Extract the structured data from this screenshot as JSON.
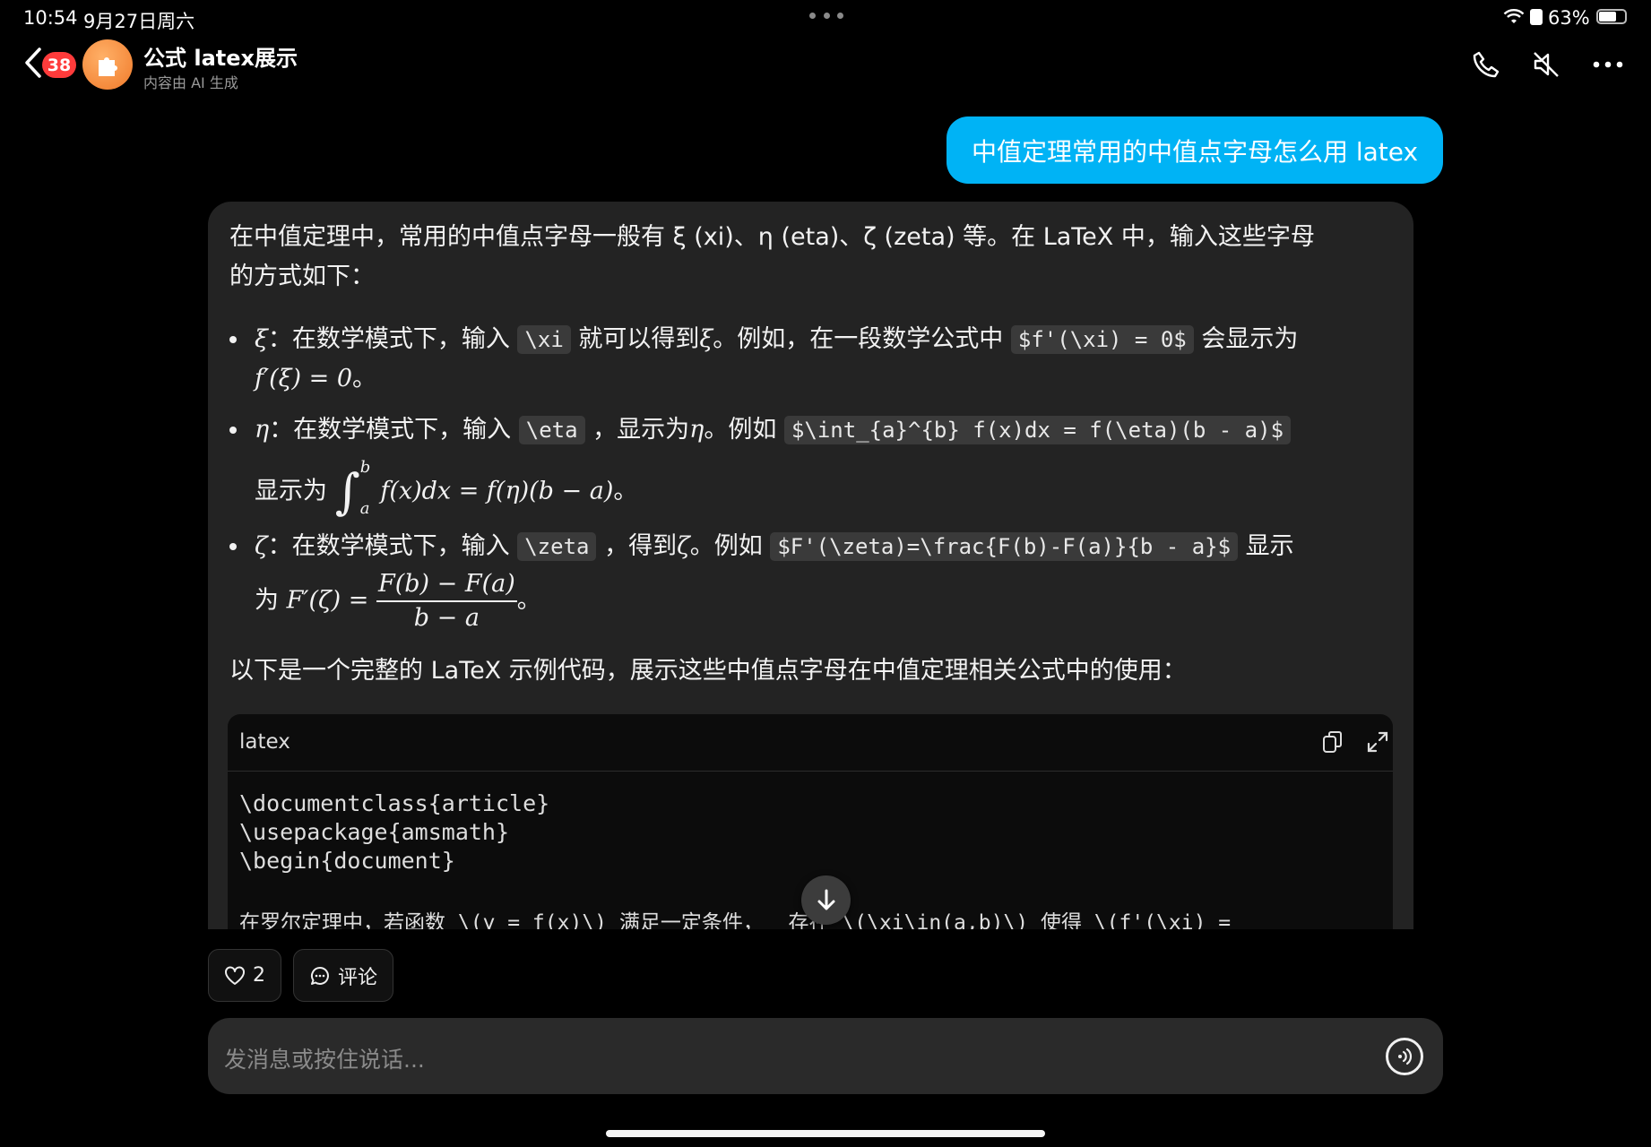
{
  "status": {
    "time": "10:54",
    "date": "9月27日周六",
    "battery": "63%"
  },
  "header": {
    "badge": "38",
    "title": "公式 latex展示",
    "subtitle": "内容由 AI 生成",
    "icons": [
      "back-icon",
      "phone-icon",
      "mute-icon",
      "more-icon"
    ]
  },
  "user_message": "中值定理常用的中值点字母怎么用 latex",
  "answer": {
    "intro_line1": "在中值定理中，常用的中值点字母一般有 ξ (xi)、η (eta)、ζ (zeta) 等。在 LaTeX 中，输入这些字母",
    "intro_line2": "的方式如下：",
    "items": [
      {
        "sym": "ξ",
        "t1": "：在数学模式下，输入",
        "code1": "\\xi",
        "t2": "就可以得到",
        "sym2": "ξ",
        "t3": "。例如，在一段数学公式中",
        "code2": "$f'(\\xi) = 0$",
        "t4": "会显示为",
        "math": "f′(ξ) = 0",
        "end": "。"
      },
      {
        "sym": "η",
        "t1": "：在数学模式下，输入",
        "code1": "\\eta",
        "t2": "，显示为",
        "sym2": "η",
        "t3": "。例如",
        "code2": "$\\int_{a}^{b} f(x)dx = f(\\eta)(b - a)$",
        "t4": "显示为",
        "int_sup": "b",
        "int_sub": "a",
        "math": "f(x)dx = f(η)(b − a)",
        "end": "。"
      },
      {
        "sym": "ζ",
        "t1": "：在数学模式下，输入",
        "code1": "\\zeta",
        "t2": "，得到",
        "sym2": "ζ",
        "t3": "。例如",
        "code2": "$F'(\\zeta)=\\frac{F(b)-F(a)}{b - a}$",
        "t4": "显示",
        "t5": "为",
        "math_left": "F′(ζ) =",
        "num": "F(b) − F(a)",
        "den": "b − a",
        "end": "。"
      }
    ],
    "outro": "以下是一个完整的 LaTeX 示例代码，展示这些中值点字母在中值定理相关公式中的使用："
  },
  "code_block": {
    "lang": "latex",
    "lines": [
      "\\documentclass{article}",
      "\\usepackage{amsmath}",
      "\\begin{document}",
      "",
      "在罗尔定理中，若函数 \\(y = f(x)\\) 满足一定条件，  存在 \\(\\xi\\in(a,b)\\) 使得 \\(f'(\\xi) ="
    ]
  },
  "actions": {
    "likes": "2",
    "comment": "评论"
  },
  "input": {
    "placeholder": "发消息或按住说话..."
  }
}
